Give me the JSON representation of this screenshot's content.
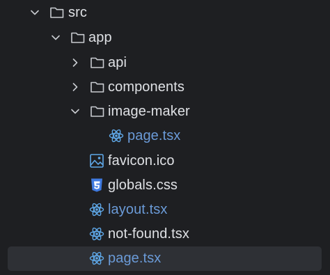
{
  "tree": {
    "items": [
      {
        "name": "src",
        "kind": "folder",
        "state": "expanded",
        "modified": false
      },
      {
        "name": "app",
        "kind": "folder",
        "state": "expanded",
        "modified": false
      },
      {
        "name": "api",
        "kind": "folder",
        "state": "collapsed",
        "modified": false
      },
      {
        "name": "components",
        "kind": "folder",
        "state": "collapsed",
        "modified": false
      },
      {
        "name": "image-maker",
        "kind": "folder",
        "state": "expanded",
        "modified": false
      },
      {
        "name": "page.tsx",
        "kind": "react-file",
        "modified": true
      },
      {
        "name": "favicon.ico",
        "kind": "image-file",
        "modified": false
      },
      {
        "name": "globals.css",
        "kind": "css-file",
        "modified": false
      },
      {
        "name": "layout.tsx",
        "kind": "react-file",
        "modified": true
      },
      {
        "name": "not-found.tsx",
        "kind": "react-file",
        "modified": false
      },
      {
        "name": "page.tsx",
        "kind": "react-file",
        "modified": true,
        "selected": true
      }
    ]
  },
  "colors": {
    "background": "#1e1f22",
    "selection": "#2e3035",
    "text": "#dfe1e5",
    "modified_text": "#6b9bd8",
    "react_icon": "#5fa8e8",
    "css_icon": "#3f7ae0",
    "icon_outline": "#c8cbd0"
  }
}
